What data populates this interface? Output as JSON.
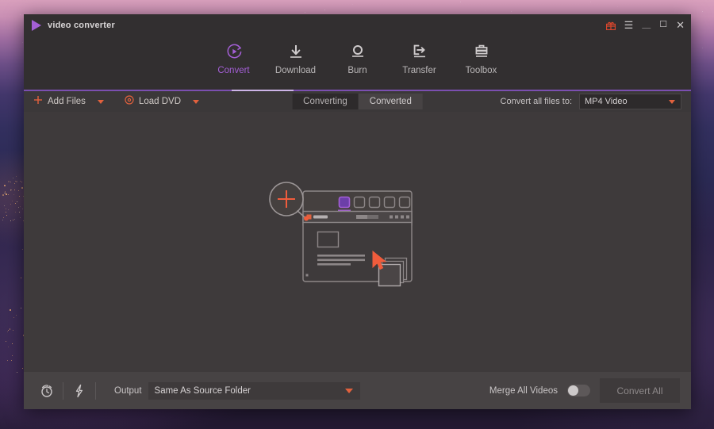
{
  "window": {
    "title": "video converter",
    "logo_icon": "play-triangle-icon",
    "controls": {
      "gift": "gift-icon",
      "menu": "☰",
      "minimize": "＿",
      "maximize": "☐",
      "close": "✕"
    }
  },
  "nav": {
    "items": [
      {
        "label": "Convert",
        "icon": "convert-circular-play-icon",
        "active": true
      },
      {
        "label": "Download",
        "icon": "download-arrow-icon",
        "active": false
      },
      {
        "label": "Burn",
        "icon": "burn-disc-icon",
        "active": false
      },
      {
        "label": "Transfer",
        "icon": "transfer-arrow-icon",
        "active": false
      },
      {
        "label": "Toolbox",
        "icon": "toolbox-icon",
        "active": false
      }
    ],
    "accent_color": "#a45fd6",
    "underline_color": "#7b4fb0"
  },
  "toolbar": {
    "add_files_label": "Add Files",
    "add_files_icon": "plus-icon",
    "load_dvd_label": "Load DVD",
    "load_dvd_icon": "disc-icon",
    "caret_icon": "chevron-down-icon",
    "tabs": [
      {
        "label": "Converting",
        "selected": true
      },
      {
        "label": "Converted",
        "selected": false
      }
    ],
    "convert_all_files_to_label": "Convert all files to:",
    "format_value": "MP4 Video",
    "format_caret_icon": "chevron-down-icon",
    "accent_color": "#e2613d"
  },
  "main": {
    "illustration": {
      "name": "add-files-empty-state-illustration",
      "plus_icon": "plus-icon",
      "tabs_count": 5,
      "active_tab_index": 0,
      "cursor_icon": "mouse-cursor-icon",
      "files_icon": "stacked-files-icon"
    }
  },
  "bottom": {
    "timer_icon": "alarm-clock-icon",
    "speed_icon": "lightning-bolt-icon",
    "output_label": "Output",
    "output_value": "Same As Source Folder",
    "output_caret_icon": "chevron-down-icon",
    "merge_label": "Merge All Videos",
    "merge_enabled": false,
    "convert_all_label": "Convert All",
    "convert_all_enabled": false
  }
}
